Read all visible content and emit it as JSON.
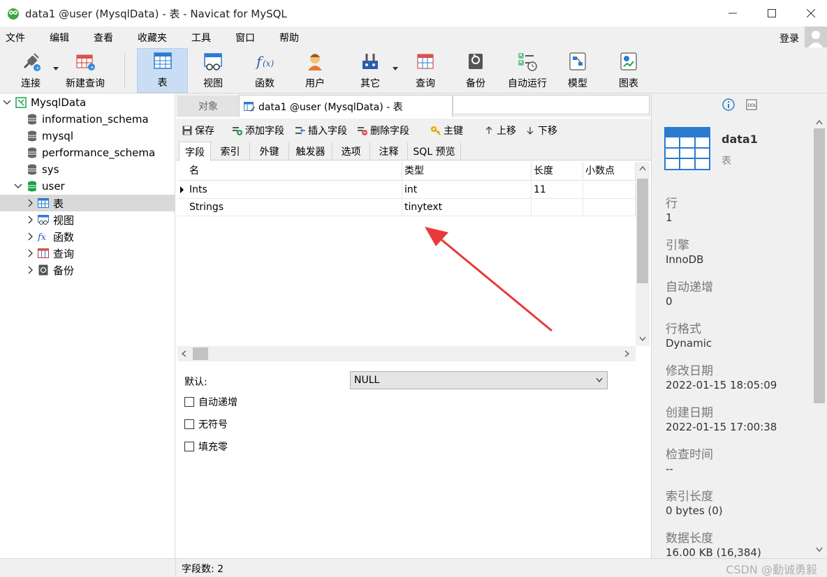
{
  "window": {
    "title": "data1 @user (MysqlData) - 表 - Navicat for MySQL",
    "minimize": "—",
    "maximize": "☐",
    "close": "✕"
  },
  "menu": {
    "items": [
      "文件",
      "编辑",
      "查看",
      "收藏夹",
      "工具",
      "窗口",
      "帮助"
    ],
    "login": "登录"
  },
  "toolbar": {
    "connect": "连接",
    "new_query": "新建查询",
    "table": "表",
    "view": "视图",
    "function": "函数",
    "user": "用户",
    "other": "其它",
    "query": "查询",
    "backup": "备份",
    "autorun": "自动运行",
    "model": "模型",
    "chart": "图表"
  },
  "tree": {
    "connection": "MysqlData",
    "dbs": [
      "information_schema",
      "mysql",
      "performance_schema",
      "sys"
    ],
    "open_db": "user",
    "children": [
      "表",
      "视图",
      "函数",
      "查询",
      "备份"
    ]
  },
  "tabs": {
    "objects": "对象",
    "active": "data1 @user (MysqlData) - 表"
  },
  "editor_toolbar": {
    "save": "保存",
    "add_field": "添加字段",
    "insert_field": "插入字段",
    "delete_field": "删除字段",
    "primary_key": "主键",
    "move_up": "上移",
    "move_down": "下移"
  },
  "sub_tabs": [
    "字段",
    "索引",
    "外键",
    "触发器",
    "选项",
    "注释",
    "SQL 预览"
  ],
  "grid": {
    "headers": [
      "名",
      "类型",
      "长度",
      "小数点"
    ],
    "rows": [
      {
        "name": "Ints",
        "type": "int",
        "length": "11",
        "decimals": ""
      },
      {
        "name": "Strings",
        "type": "tinytext",
        "length": "",
        "decimals": ""
      }
    ]
  },
  "props": {
    "default_label": "默认:",
    "default_value": "NULL",
    "auto_increment": "自动递增",
    "unsigned": "无符号",
    "zerofill": "填充零"
  },
  "info": {
    "name": "data1",
    "type": "表",
    "fields": [
      {
        "k": "行",
        "v": "1"
      },
      {
        "k": "引擎",
        "v": "InnoDB"
      },
      {
        "k": "自动递增",
        "v": "0"
      },
      {
        "k": "行格式",
        "v": "Dynamic"
      },
      {
        "k": "修改日期",
        "v": "2022-01-15 18:05:09"
      },
      {
        "k": "创建日期",
        "v": "2022-01-15 17:00:38"
      },
      {
        "k": "检查时间",
        "v": "--"
      },
      {
        "k": "索引长度",
        "v": "0 bytes (0)"
      },
      {
        "k": "数据长度",
        "v": "16.00 KB (16,384)"
      }
    ]
  },
  "status": {
    "field_count": "字段数: 2",
    "watermark": "CSDN @勤诚勇毅"
  },
  "colors": {
    "accent_selected": "#c9def5",
    "arrow_red": "#e83a3a",
    "db_green": "#1aa34a"
  }
}
